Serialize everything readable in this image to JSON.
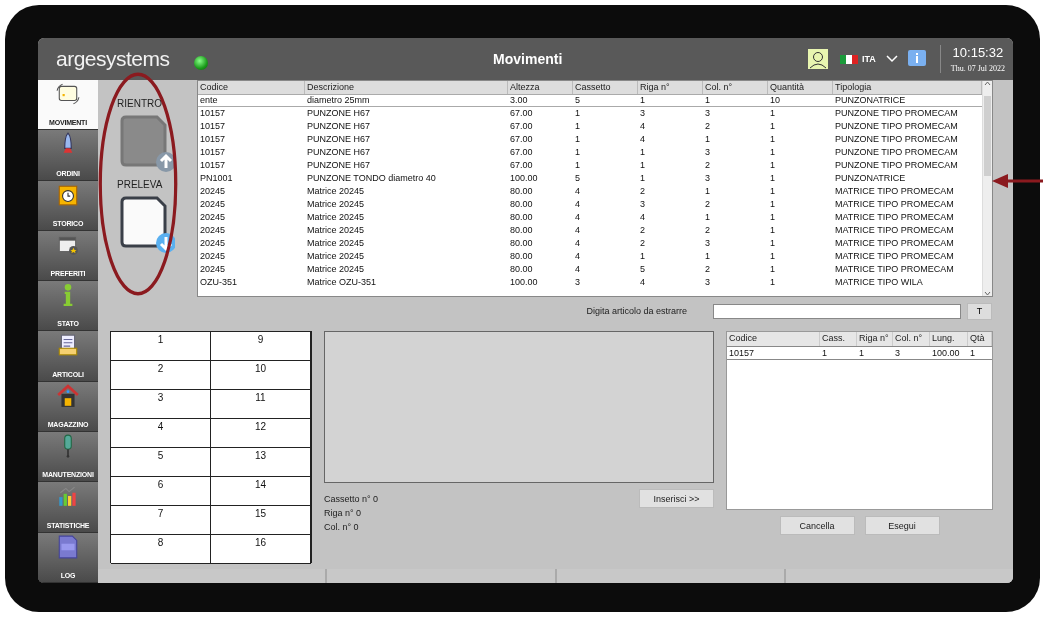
{
  "header": {
    "brand": "argesystems",
    "connected": true,
    "title": "Movimenti",
    "language": "ITA",
    "time": "10:15:32",
    "date": "Thu. 07 Jul 2022"
  },
  "sidebar": {
    "items": [
      {
        "label": "MOVIMENTI",
        "kind": "moves",
        "selected": true
      },
      {
        "label": "ORDINI",
        "kind": "orders",
        "selected": false
      },
      {
        "label": "STORICO",
        "kind": "history",
        "selected": false
      },
      {
        "label": "PREFERITI",
        "kind": "favorites",
        "selected": false
      },
      {
        "label": "STATO",
        "kind": "status",
        "selected": false
      },
      {
        "label": "ARTICOLI",
        "kind": "articles",
        "selected": false
      },
      {
        "label": "MAGAZZINO",
        "kind": "warehouse",
        "selected": false
      },
      {
        "label": "MANUTENZIONI",
        "kind": "maintenance",
        "selected": false
      },
      {
        "label": "STATISTICHE",
        "kind": "stats",
        "selected": false
      },
      {
        "label": "LOG",
        "kind": "log",
        "selected": false
      }
    ]
  },
  "actions": [
    {
      "label": "RIENTRO",
      "kind": "return",
      "disabled": true
    },
    {
      "label": "PRELEVA",
      "kind": "pick",
      "disabled": false
    }
  ],
  "table": {
    "columns": [
      "Codice",
      "Descrizione",
      "Altezza",
      "Cassetto",
      "Riga n°",
      "Col. n°",
      "Quantità",
      "Tipologia"
    ],
    "rows": [
      {
        "selected": true,
        "cells": [
          "ente",
          "diametro 25mm",
          "3.00",
          "5",
          "1",
          "1",
          "10",
          "PUNZONATRICE"
        ]
      },
      {
        "selected": false,
        "cells": [
          "10157",
          "PUNZONE H67",
          "67.00",
          "1",
          "3",
          "3",
          "1",
          "PUNZONE TIPO PROMECAM"
        ]
      },
      {
        "selected": false,
        "cells": [
          "10157",
          "PUNZONE H67",
          "67.00",
          "1",
          "4",
          "2",
          "1",
          "PUNZONE TIPO PROMECAM"
        ]
      },
      {
        "selected": false,
        "cells": [
          "10157",
          "PUNZONE H67",
          "67.00",
          "1",
          "4",
          "1",
          "1",
          "PUNZONE TIPO PROMECAM"
        ]
      },
      {
        "selected": false,
        "cells": [
          "10157",
          "PUNZONE H67",
          "67.00",
          "1",
          "1",
          "3",
          "1",
          "PUNZONE TIPO PROMECAM"
        ]
      },
      {
        "selected": false,
        "cells": [
          "10157",
          "PUNZONE H67",
          "67.00",
          "1",
          "1",
          "2",
          "1",
          "PUNZONE TIPO PROMECAM"
        ]
      },
      {
        "selected": false,
        "cells": [
          "PN1001",
          "PUNZONE TONDO diametro 40",
          "100.00",
          "5",
          "1",
          "3",
          "1",
          "PUNZONATRICE"
        ]
      },
      {
        "selected": false,
        "cells": [
          "20245",
          "Matrice 20245",
          "80.00",
          "4",
          "2",
          "1",
          "1",
          "MATRICE TIPO PROMECAM"
        ]
      },
      {
        "selected": false,
        "cells": [
          "20245",
          "Matrice 20245",
          "80.00",
          "4",
          "3",
          "2",
          "1",
          "MATRICE TIPO PROMECAM"
        ]
      },
      {
        "selected": false,
        "cells": [
          "20245",
          "Matrice 20245",
          "80.00",
          "4",
          "4",
          "1",
          "1",
          "MATRICE TIPO PROMECAM"
        ]
      },
      {
        "selected": false,
        "cells": [
          "20245",
          "Matrice 20245",
          "80.00",
          "4",
          "2",
          "2",
          "1",
          "MATRICE TIPO PROMECAM"
        ]
      },
      {
        "selected": false,
        "cells": [
          "20245",
          "Matrice 20245",
          "80.00",
          "4",
          "2",
          "3",
          "1",
          "MATRICE TIPO PROMECAM"
        ]
      },
      {
        "selected": false,
        "cells": [
          "20245",
          "Matrice 20245",
          "80.00",
          "4",
          "1",
          "1",
          "1",
          "MATRICE TIPO PROMECAM"
        ]
      },
      {
        "selected": false,
        "cells": [
          "20245",
          "Matrice 20245",
          "80.00",
          "4",
          "5",
          "2",
          "1",
          "MATRICE TIPO PROMECAM"
        ]
      },
      {
        "selected": false,
        "cells": [
          "OZU-351",
          "Matrice OZU-351",
          "100.00",
          "3",
          "4",
          "3",
          "1",
          "MATRICE TIPO WILA"
        ]
      }
    ]
  },
  "search": {
    "label": "Digita articolo da estrarre",
    "button": "T"
  },
  "drawers": [
    "1",
    "2",
    "3",
    "4",
    "5",
    "6",
    "7",
    "8",
    "9",
    "10",
    "11",
    "12",
    "13",
    "14",
    "15",
    "16"
  ],
  "location": [
    "Cassetto n° 0",
    "Riga n° 0",
    "Col. n° 0"
  ],
  "insert_button": "Inserisci >>",
  "list": {
    "columns": [
      "Codice",
      "Cass.",
      "Riga n°",
      "Col. n°",
      "Lung.",
      "Qtà"
    ],
    "rows": [
      [
        "10157",
        "1",
        "1",
        "3",
        "100.00",
        "1"
      ]
    ]
  },
  "buttons": [
    "Cancella",
    "Esegui"
  ]
}
